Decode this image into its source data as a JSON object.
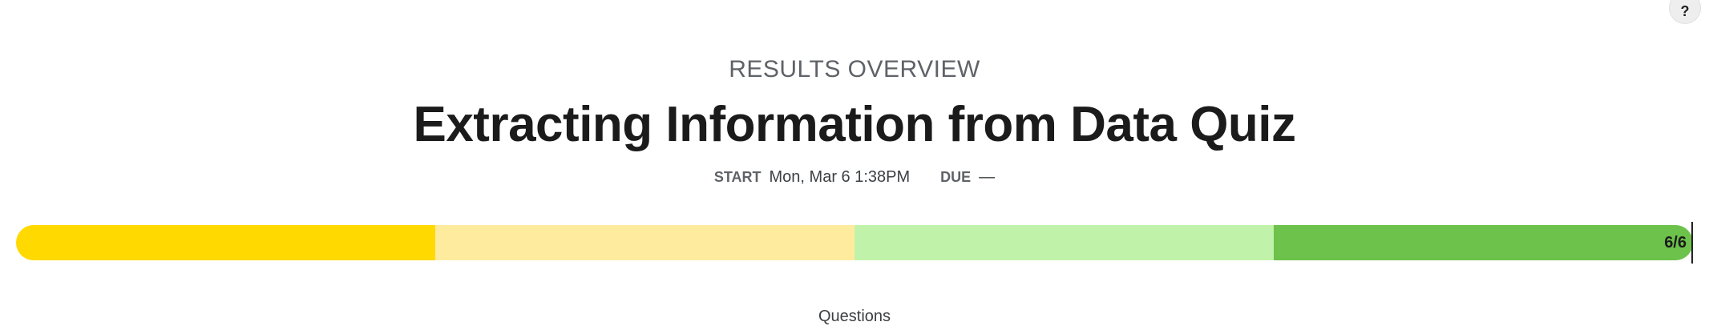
{
  "help": {
    "label": "?"
  },
  "header": {
    "eyebrow": "RESULTS OVERVIEW",
    "title": "Extracting Information from Data Quiz"
  },
  "meta": {
    "start_label": "START",
    "start_value": "Mon, Mar 6 1:38PM",
    "due_label": "DUE",
    "due_value": "—"
  },
  "progress": {
    "label": "6/6",
    "segments": [
      {
        "color": "#ffd900"
      },
      {
        "color": "#ffeb9e"
      },
      {
        "color": "#c0f3a9"
      },
      {
        "color": "#6cc24a"
      }
    ]
  },
  "questions": {
    "label": "Questions"
  }
}
